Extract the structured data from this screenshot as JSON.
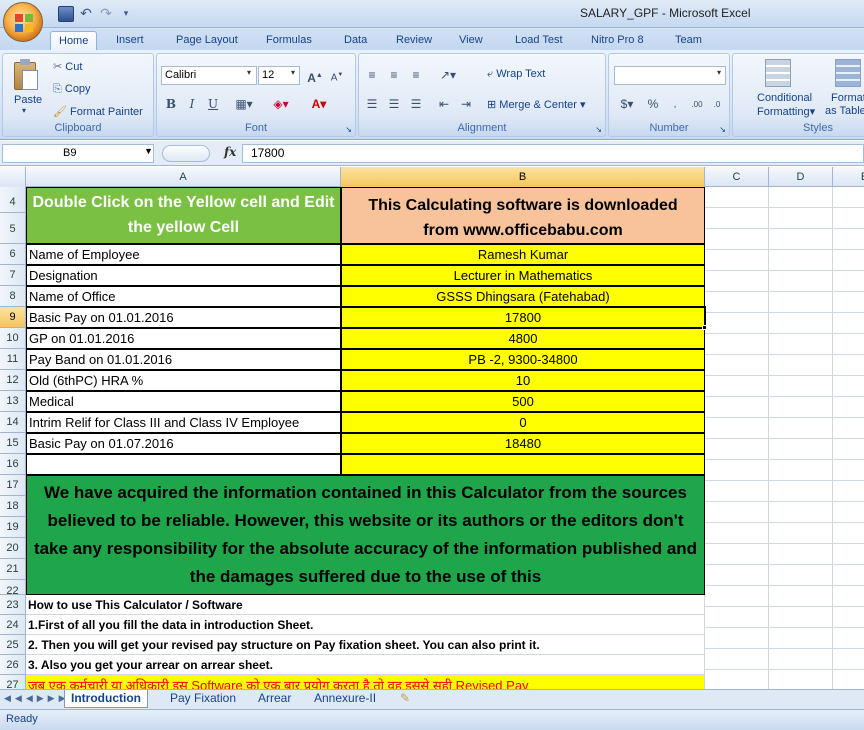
{
  "window": {
    "title": "SALARY_GPF - Microsoft Excel"
  },
  "tabs": [
    "Home",
    "Insert",
    "Page Layout",
    "Formulas",
    "Data",
    "Review",
    "View",
    "Load Test",
    "Nitro Pro 8",
    "Team"
  ],
  "ribbon": {
    "clipboard": {
      "label": "Clipboard",
      "paste": "Paste",
      "cut": "Cut",
      "copy": "Copy",
      "format_painter": "Format Painter"
    },
    "font": {
      "label": "Font",
      "name": "Calibri",
      "size": "12"
    },
    "alignment": {
      "label": "Alignment",
      "wrap": "Wrap Text",
      "merge": "Merge & Center"
    },
    "number": {
      "label": "Number",
      "format": ""
    },
    "styles": {
      "label": "Styles",
      "conditional_1": "Conditional",
      "conditional_2": "Formatting",
      "format_table_1": "Format",
      "format_table_2": "as Table"
    }
  },
  "formula_bar": {
    "name_box": "B9",
    "fx": "fx",
    "content": "17800"
  },
  "columns": [
    "A",
    "B",
    "C",
    "D",
    "E"
  ],
  "rows": {
    "r4_5_a": "Double Click on the Yellow cell and Edit the yellow Cell",
    "r4_5_b": "This Calculating software is downloaded from www.officebabu.com",
    "fields": [
      {
        "row": "6",
        "label": "Name of Employee",
        "value": "Ramesh Kumar"
      },
      {
        "row": "7",
        "label": "Designation",
        "value": "Lecturer in Mathematics"
      },
      {
        "row": "8",
        "label": "Name of Office",
        "value": "GSSS Dhingsara (Fatehabad)"
      },
      {
        "row": "9",
        "label": "Basic Pay on 01.01.2016",
        "value": "17800"
      },
      {
        "row": "10",
        "label": "GP on 01.01.2016",
        "value": "4800"
      },
      {
        "row": "11",
        "label": "Pay Band on 01.01.2016",
        "value": "PB -2,   9300-34800"
      },
      {
        "row": "12",
        "label": "Old (6thPC) HRA %",
        "value": "10"
      },
      {
        "row": "13",
        "label": "Medical",
        "value": "500"
      },
      {
        "row": "14",
        "label": "Intrim Relif for Class III and Class IV Employee",
        "value": "0"
      },
      {
        "row": "15",
        "label": "Basic Pay on 01.07.2016",
        "value": "18480"
      }
    ],
    "disclaimer": "We have acquired the information contained in this Calculator from the sources believed to be reliable. However, this website or its authors or the editors don't take any responsibility for the absolute accuracy of the information published and the damages suffered due to the use of this",
    "how_to": "How to use This Calculator / Software",
    "step1": "1.First of all you fill the data in introduction Sheet.",
    "step2": "2. Then you will get your revised pay structure on Pay fixation sheet. You can also print it.",
    "step3": "3. Also you get your arrear on arrear sheet.",
    "row27": "जब एक कर्मचारी या अधिकारी इस Software को एक बार प्रयोग करता है तो वह इससे सही Revised Pay"
  },
  "row_numbers": [
    "4",
    "5",
    "6",
    "7",
    "8",
    "9",
    "10",
    "11",
    "12",
    "13",
    "14",
    "15",
    "16",
    "17",
    "18",
    "19",
    "20",
    "21",
    "22",
    "23",
    "24",
    "25",
    "26",
    "27"
  ],
  "sheets": [
    "Introduction",
    "Pay Fixation",
    "Arrear",
    "Annexure-II"
  ],
  "status": "Ready",
  "colors": {
    "yellow": "#ffff00",
    "green_header": "#7ac143",
    "peach": "#f8c29a",
    "disclaimer_green": "#1fa54a",
    "red_text": "#ff0000"
  }
}
